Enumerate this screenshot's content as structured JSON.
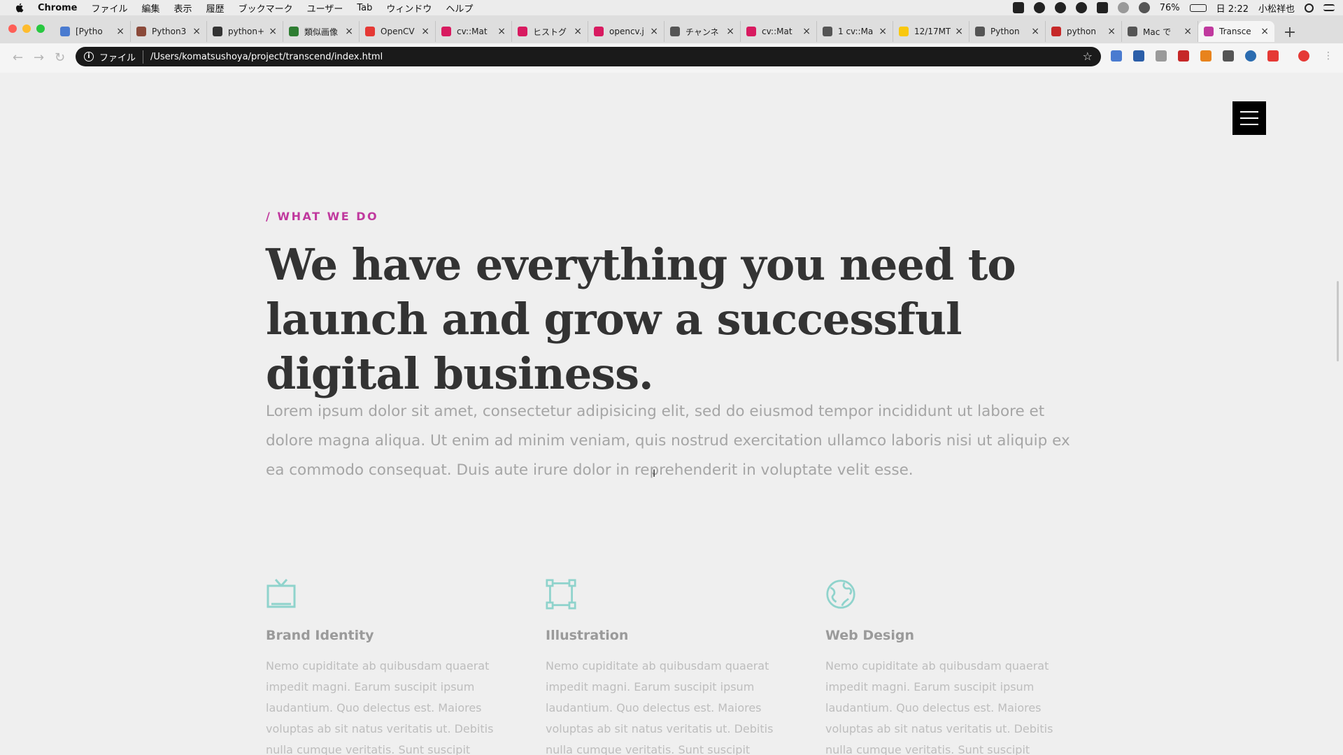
{
  "menubar": {
    "app": "Chrome",
    "items": [
      "ファイル",
      "編集",
      "表示",
      "履歴",
      "ブックマーク",
      "ユーザー",
      "Tab",
      "ウィンドウ",
      "ヘルプ"
    ],
    "battery": "76%",
    "clock": "日 2:22",
    "user": "小松祥也"
  },
  "tabs": [
    {
      "title": "[Pytho",
      "fav_color": "#4a7bd0"
    },
    {
      "title": "Python3",
      "fav_color": "#8b4a3a"
    },
    {
      "title": "python+",
      "fav_color": "#333333"
    },
    {
      "title": "類似画像",
      "fav_color": "#2e7d32"
    },
    {
      "title": "OpenCV",
      "fav_color": "#e53935"
    },
    {
      "title": "cv::Mat",
      "fav_color": "#d81b60"
    },
    {
      "title": "ヒストグ",
      "fav_color": "#d81b60"
    },
    {
      "title": "opencv.j",
      "fav_color": "#d81b60"
    },
    {
      "title": "チャンネ",
      "fav_color": "#555555"
    },
    {
      "title": "cv::Mat",
      "fav_color": "#d81b60"
    },
    {
      "title": "1 cv::Ma",
      "fav_color": "#555555"
    },
    {
      "title": "12/17MT",
      "fav_color": "#f9c80e"
    },
    {
      "title": "Python",
      "fav_color": "#555555"
    },
    {
      "title": "python",
      "fav_color": "#c62828"
    },
    {
      "title": "Mac で",
      "fav_color": "#555555"
    },
    {
      "title": "Transce",
      "fav_color": "#c0399e",
      "active": true
    }
  ],
  "omnibox": {
    "label": "ファイル",
    "url": "/Users/komatsushoya/project/transcend/index.html"
  },
  "page": {
    "eyebrow": "/ WHAT WE DO",
    "headline": "We have everything you need to launch and grow a successful digital business.",
    "lede": "Lorem ipsum dolor sit amet, consectetur adipisicing elit, sed do eiusmod tempor incididunt ut labore et dolore magna aliqua. Ut enim ad minim veniam, quis nostrud exercitation ullamco laboris nisi ut aliquip ex ea commodo consequat. Duis aute irure dolor in reprehenderit in voluptate velit esse.",
    "features": [
      {
        "title": "Brand Identity",
        "icon": "tv-icon",
        "body": "Nemo cupiditate ab quibusdam quaerat impedit magni. Earum suscipit ipsum laudantium. Quo delectus est. Maiores voluptas ab sit natus veritatis ut. Debitis nulla cumque veritatis. Sunt suscipit"
      },
      {
        "title": "Illustration",
        "icon": "frame-icon",
        "body": "Nemo cupiditate ab quibusdam quaerat impedit magni. Earum suscipit ipsum laudantium. Quo delectus est. Maiores voluptas ab sit natus veritatis ut. Debitis nulla cumque veritatis. Sunt suscipit"
      },
      {
        "title": "Web Design",
        "icon": "globe-icon",
        "body": "Nemo cupiditate ab quibusdam quaerat impedit magni. Earum suscipit ipsum laudantium. Quo delectus est. Maiores voluptas ab sit natus veritatis ut. Debitis nulla cumque veritatis. Sunt suscipit"
      }
    ]
  },
  "colors": {
    "accent": "#c0399e",
    "icon_teal": "#8fd3cc",
    "headline": "#333333"
  }
}
